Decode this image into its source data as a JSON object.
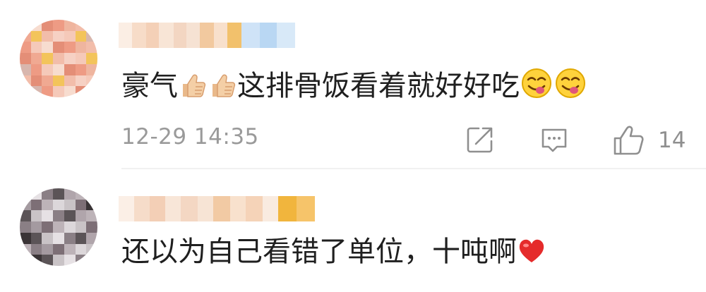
{
  "comments": [
    {
      "text": "这排骨饭看着就好好吃",
      "prefix": "豪气",
      "timestamp": "12-29 14:35",
      "like_count": "14",
      "icons": [
        "thumbs-up-emoji",
        "thumbs-up-emoji",
        "face-savoring-food-emoji",
        "face-savoring-food-emoji",
        "share-icon",
        "comment-icon",
        "like-icon"
      ]
    },
    {
      "text": "还以为自己看错了单位，十吨啊",
      "icons": [
        "red-heart-emoji"
      ]
    }
  ],
  "colors": {
    "text": "#1f1f1f",
    "meta": "#9a9a9a",
    "icon": "#8f8f8f",
    "divider": "#f1f1f1"
  }
}
